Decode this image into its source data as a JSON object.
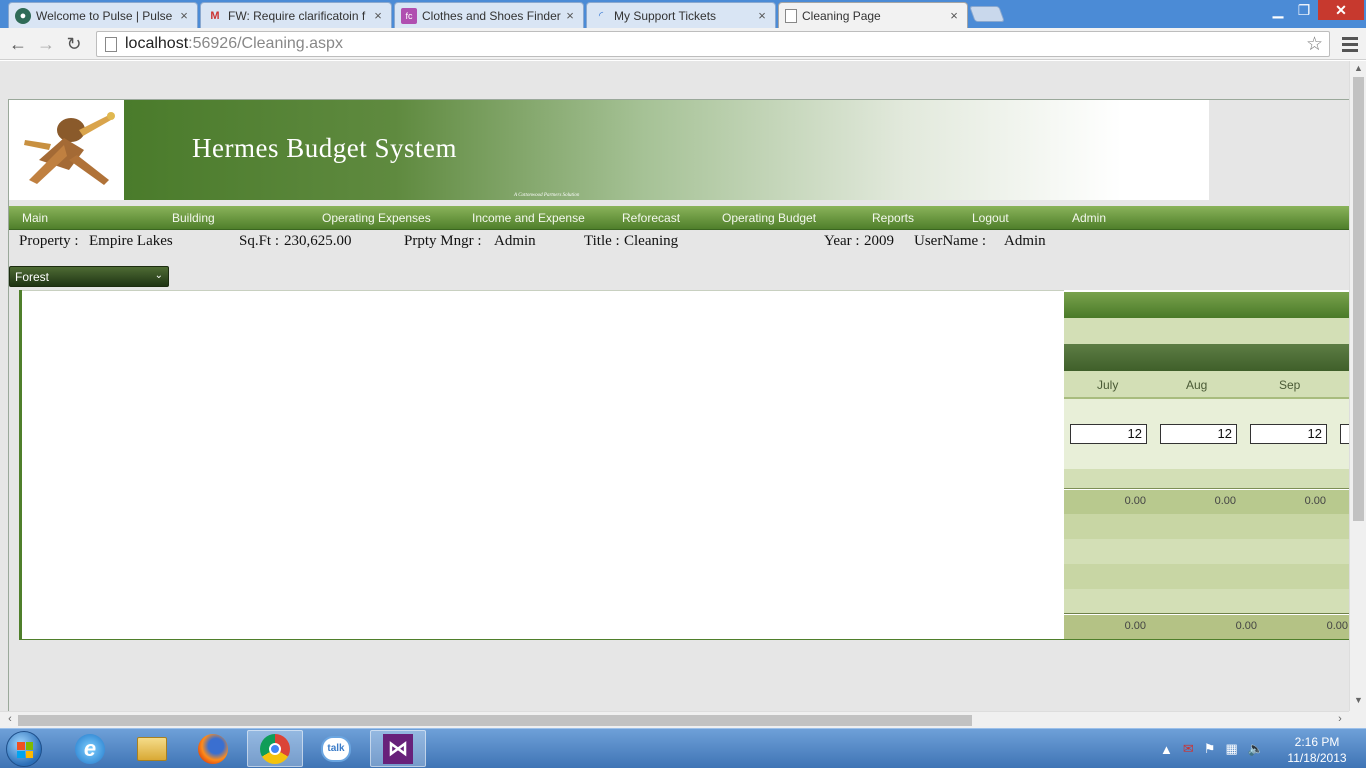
{
  "browser": {
    "tabs": [
      {
        "title": "Welcome to Pulse | Pulse",
        "favicon": "pulse-icon"
      },
      {
        "title": "FW: Require clarificatoin f",
        "favicon": "gmail-icon"
      },
      {
        "title": "Clothes and Shoes Finder",
        "favicon": "finder-icon"
      },
      {
        "title": "My Support Tickets",
        "favicon": "loading-icon"
      },
      {
        "title": "Cleaning Page",
        "favicon": "page-icon"
      }
    ],
    "url_host": "localhost",
    "url_path": ":56926/Cleaning.aspx"
  },
  "app": {
    "title": "Hermes Budget System",
    "tagline": "A Cottonwood Partners Solution"
  },
  "nav": [
    {
      "label": "Main"
    },
    {
      "label": "Building"
    },
    {
      "label": "Operating Expenses"
    },
    {
      "label": "Income and Expense"
    },
    {
      "label": "Reforecast"
    },
    {
      "label": "Operating Budget"
    },
    {
      "label": "Reports"
    },
    {
      "label": "Logout"
    },
    {
      "label": "Admin"
    }
  ],
  "info": {
    "property_label": "Property :",
    "property_value": "Empire Lakes",
    "sqft_label": "Sq.Ft :",
    "sqft_value": "230,625.00",
    "manager_label": "Prpty Mngr :",
    "manager_value": "Admin",
    "title_label": "Title :",
    "title_value": "Cleaning",
    "year_label": "Year :",
    "year_value": "2009",
    "username_label": "UserName :",
    "username_value": "Admin"
  },
  "theme_select": {
    "value": "Forest"
  },
  "grid": {
    "months": [
      "July",
      "Aug",
      "Sep"
    ],
    "inputs": [
      "12",
      "12",
      "12"
    ],
    "subtotals": [
      "0.00",
      "0.00",
      "0.00"
    ],
    "totals": [
      "0.00",
      "0.00",
      "0.00"
    ]
  },
  "taskbar": {
    "time": "2:16 PM",
    "date": "11/18/2013"
  },
  "colors": {
    "nav_green": "#4f7f2b",
    "grid_light": "#d3dfb6",
    "grid_header": "#4a6a34"
  }
}
